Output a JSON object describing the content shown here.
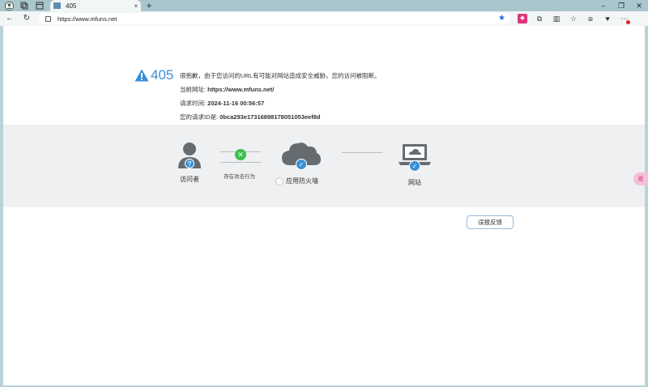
{
  "browser": {
    "tab_title": "405",
    "url": "https://www.mfuns.net",
    "new_tab": "+",
    "close_tab": "×"
  },
  "page": {
    "error_code": "405",
    "message": "很抱歉，由于您访问的URL有可能对网站造成安全威胁，您的访问被阻断。",
    "current_url_label": "当前网址: ",
    "current_url": "https://www.mfuns.net/",
    "request_time_label": "请求时间: ",
    "request_time": "2024-11-16 00:56:57",
    "request_id_label": "您的请求ID是: ",
    "request_id": "0bca293e17316898178051053eef8d",
    "visitor_label": "访问者",
    "attack_label": "存在攻击行为",
    "firewall_label": "应用防火墙",
    "website_label": "网站",
    "feedback_button": "误报反馈",
    "side_badge": "论"
  },
  "colors": {
    "accent": "#3a8fd6",
    "ok_green": "#3bbf4b",
    "band": "#eef0f2"
  }
}
